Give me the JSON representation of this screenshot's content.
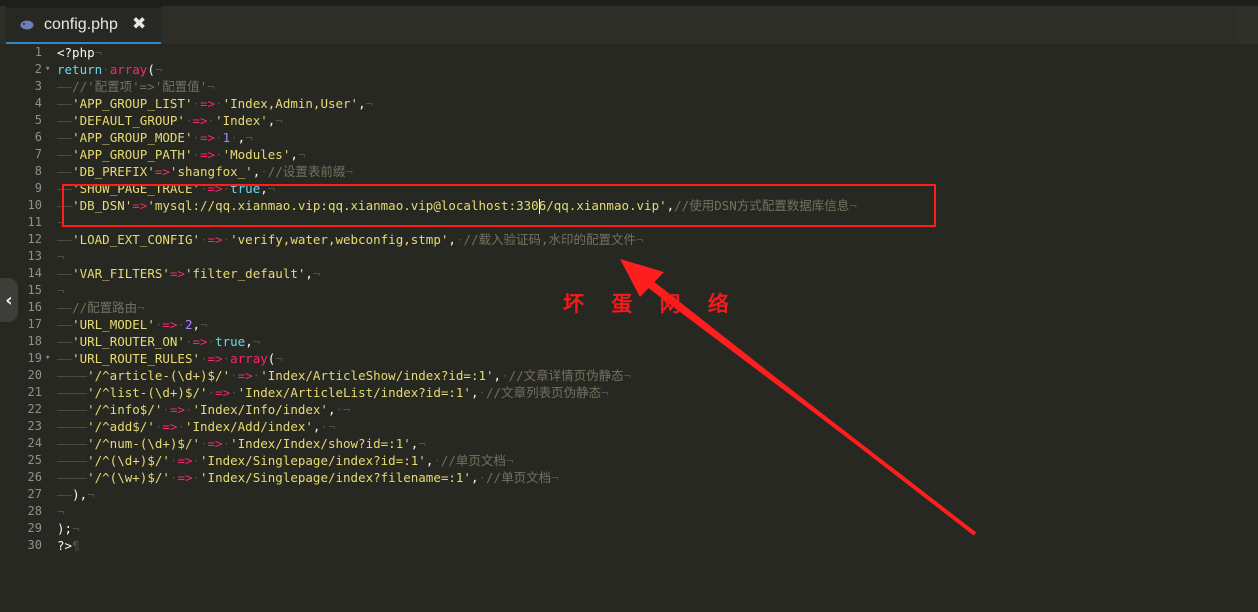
{
  "tab": {
    "title": "config.php",
    "icon": "php-elephant-icon",
    "close": "✖"
  },
  "side_handle": "‹",
  "watermark": "坏 蛋 网 络",
  "lines": [
    {
      "n": "1",
      "fold": "",
      "segs": [
        [
          "t",
          "<?php"
        ],
        [
          "inv",
          "¬"
        ]
      ]
    },
    {
      "n": "2",
      "fold": "▾",
      "segs": [
        [
          "k",
          "return"
        ],
        [
          "inv",
          "·"
        ],
        [
          "o",
          "array"
        ],
        [
          "t",
          "("
        ],
        [
          "inv",
          "¬"
        ]
      ]
    },
    {
      "n": "3",
      "fold": "",
      "segs": [
        [
          "inv",
          "——"
        ],
        [
          "c",
          "//'配置项'=>'配置值'"
        ],
        [
          "inv",
          "¬"
        ]
      ]
    },
    {
      "n": "4",
      "fold": "",
      "segs": [
        [
          "inv",
          "——"
        ],
        [
          "s",
          "'APP_GROUP_LIST'"
        ],
        [
          "inv",
          "·"
        ],
        [
          "o",
          "=>"
        ],
        [
          "inv",
          "·"
        ],
        [
          "s",
          "'Index,Admin,User'"
        ],
        [
          "t",
          ","
        ],
        [
          "inv",
          "¬"
        ]
      ]
    },
    {
      "n": "5",
      "fold": "",
      "segs": [
        [
          "inv",
          "——"
        ],
        [
          "s",
          "'DEFAULT_GROUP'"
        ],
        [
          "inv",
          "·"
        ],
        [
          "o",
          "=>"
        ],
        [
          "inv",
          "·"
        ],
        [
          "s",
          "'Index'"
        ],
        [
          "t",
          ","
        ],
        [
          "inv",
          "¬"
        ]
      ]
    },
    {
      "n": "6",
      "fold": "",
      "segs": [
        [
          "inv",
          "——"
        ],
        [
          "s",
          "'APP_GROUP_MODE'"
        ],
        [
          "inv",
          "·"
        ],
        [
          "o",
          "=>"
        ],
        [
          "inv",
          "·"
        ],
        [
          "n",
          "1"
        ],
        [
          "inv",
          "·"
        ],
        [
          "t",
          ","
        ],
        [
          "inv",
          "¬"
        ]
      ]
    },
    {
      "n": "7",
      "fold": "",
      "segs": [
        [
          "inv",
          "——"
        ],
        [
          "s",
          "'APP_GROUP_PATH'"
        ],
        [
          "inv",
          "·"
        ],
        [
          "o",
          "=>"
        ],
        [
          "inv",
          "·"
        ],
        [
          "s",
          "'Modules'"
        ],
        [
          "t",
          ","
        ],
        [
          "inv",
          "¬"
        ]
      ]
    },
    {
      "n": "8",
      "fold": "",
      "segs": [
        [
          "inv",
          "——"
        ],
        [
          "s",
          "'DB_PREFIX'"
        ],
        [
          "o",
          "=>"
        ],
        [
          "s",
          "'shangfox_'"
        ],
        [
          "t",
          ","
        ],
        [
          "inv",
          "·"
        ],
        [
          "c",
          "//设置表前缀"
        ],
        [
          "inv",
          "¬"
        ]
      ]
    },
    {
      "n": "9",
      "fold": "",
      "segs": [
        [
          "inv",
          "——"
        ],
        [
          "s",
          "'SHOW_PAGE_TRACE'"
        ],
        [
          "inv",
          "·"
        ],
        [
          "o",
          "=>"
        ],
        [
          "inv",
          "·"
        ],
        [
          "k",
          "true"
        ],
        [
          "t",
          ","
        ],
        [
          "inv",
          "¬"
        ]
      ]
    },
    {
      "n": "10",
      "fold": "",
      "segs": [
        [
          "inv",
          "——"
        ],
        [
          "s",
          "'DB_DSN'"
        ],
        [
          "o",
          "=>"
        ],
        [
          "s",
          "'mysql://qq.xianmao.vip:qq.xianmao.vip@localhost:330"
        ],
        [
          "caret",
          ""
        ],
        [
          "s",
          "6/qq.xianmao.vip'"
        ],
        [
          "t",
          ","
        ],
        [
          "c",
          "//使用DSN方式配置数据库信息"
        ],
        [
          "inv",
          "¬"
        ]
      ]
    },
    {
      "n": "11",
      "fold": "",
      "segs": [
        [
          "inv",
          "¬"
        ]
      ]
    },
    {
      "n": "12",
      "fold": "",
      "segs": [
        [
          "inv",
          "——"
        ],
        [
          "s",
          "'LOAD_EXT_CONFIG'"
        ],
        [
          "inv",
          "·"
        ],
        [
          "o",
          "=>"
        ],
        [
          "inv",
          "·"
        ],
        [
          "s",
          "'verify,water,webconfig,stmp'"
        ],
        [
          "t",
          ","
        ],
        [
          "inv",
          "·"
        ],
        [
          "c",
          "//载入验证码,水印的配置文件"
        ],
        [
          "inv",
          "¬"
        ]
      ]
    },
    {
      "n": "13",
      "fold": "",
      "segs": [
        [
          "inv",
          "¬"
        ]
      ]
    },
    {
      "n": "14",
      "fold": "",
      "segs": [
        [
          "inv",
          "——"
        ],
        [
          "s",
          "'VAR_FILTERS'"
        ],
        [
          "o",
          "=>"
        ],
        [
          "s",
          "'filter_default'"
        ],
        [
          "t",
          ","
        ],
        [
          "inv",
          "¬"
        ]
      ]
    },
    {
      "n": "15",
      "fold": "",
      "segs": [
        [
          "inv",
          "¬"
        ]
      ]
    },
    {
      "n": "16",
      "fold": "",
      "segs": [
        [
          "inv",
          "——"
        ],
        [
          "c",
          "//配置路由"
        ],
        [
          "inv",
          "¬"
        ]
      ]
    },
    {
      "n": "17",
      "fold": "",
      "segs": [
        [
          "inv",
          "——"
        ],
        [
          "s",
          "'URL_MODEL'"
        ],
        [
          "inv",
          "·"
        ],
        [
          "o",
          "=>"
        ],
        [
          "inv",
          "·"
        ],
        [
          "n",
          "2"
        ],
        [
          "t",
          ","
        ],
        [
          "inv",
          "¬"
        ]
      ]
    },
    {
      "n": "18",
      "fold": "",
      "segs": [
        [
          "inv",
          "——"
        ],
        [
          "s",
          "'URL_ROUTER_ON'"
        ],
        [
          "inv",
          "·"
        ],
        [
          "o",
          "=>"
        ],
        [
          "inv",
          "·"
        ],
        [
          "k",
          "true"
        ],
        [
          "t",
          ","
        ],
        [
          "inv",
          "¬"
        ]
      ]
    },
    {
      "n": "19",
      "fold": "▾",
      "segs": [
        [
          "inv",
          "——"
        ],
        [
          "s",
          "'URL_ROUTE_RULES'"
        ],
        [
          "inv",
          "·"
        ],
        [
          "o",
          "=>"
        ],
        [
          "inv",
          "·"
        ],
        [
          "o",
          "array"
        ],
        [
          "t",
          "("
        ],
        [
          "inv",
          "¬"
        ]
      ]
    },
    {
      "n": "20",
      "fold": "",
      "segs": [
        [
          "inv",
          "————"
        ],
        [
          "s",
          "'/^article-(\\d+)$/'"
        ],
        [
          "inv",
          "·"
        ],
        [
          "o",
          "=>"
        ],
        [
          "inv",
          "·"
        ],
        [
          "s",
          "'Index/ArticleShow/index?id=:1'"
        ],
        [
          "t",
          ","
        ],
        [
          "inv",
          "·"
        ],
        [
          "c",
          "//文章详情页伪静态"
        ],
        [
          "inv",
          "¬"
        ]
      ]
    },
    {
      "n": "21",
      "fold": "",
      "segs": [
        [
          "inv",
          "————"
        ],
        [
          "s",
          "'/^list-(\\d+)$/'"
        ],
        [
          "inv",
          "·"
        ],
        [
          "o",
          "=>"
        ],
        [
          "inv",
          "·"
        ],
        [
          "s",
          "'Index/ArticleList/index?id=:1'"
        ],
        [
          "t",
          ","
        ],
        [
          "inv",
          "·"
        ],
        [
          "c",
          "//文章列表页伪静态"
        ],
        [
          "inv",
          "¬"
        ]
      ]
    },
    {
      "n": "22",
      "fold": "",
      "segs": [
        [
          "inv",
          "————"
        ],
        [
          "s",
          "'/^info$/'"
        ],
        [
          "inv",
          "·"
        ],
        [
          "o",
          "=>"
        ],
        [
          "inv",
          "·"
        ],
        [
          "s",
          "'Index/Info/index'"
        ],
        [
          "t",
          ","
        ],
        [
          "inv",
          "·¬"
        ]
      ]
    },
    {
      "n": "23",
      "fold": "",
      "segs": [
        [
          "inv",
          "————"
        ],
        [
          "s",
          "'/^add$/'"
        ],
        [
          "inv",
          "·"
        ],
        [
          "o",
          "=>"
        ],
        [
          "inv",
          "·"
        ],
        [
          "s",
          "'Index/Add/index'"
        ],
        [
          "t",
          ","
        ],
        [
          "inv",
          "·¬"
        ]
      ]
    },
    {
      "n": "24",
      "fold": "",
      "segs": [
        [
          "inv",
          "————"
        ],
        [
          "s",
          "'/^num-(\\d+)$/'"
        ],
        [
          "inv",
          "·"
        ],
        [
          "o",
          "=>"
        ],
        [
          "inv",
          "·"
        ],
        [
          "s",
          "'Index/Index/show?id=:1'"
        ],
        [
          "t",
          ","
        ],
        [
          "inv",
          "¬"
        ]
      ]
    },
    {
      "n": "25",
      "fold": "",
      "segs": [
        [
          "inv",
          "————"
        ],
        [
          "s",
          "'/^(\\d+)$/'"
        ],
        [
          "inv",
          "·"
        ],
        [
          "o",
          "=>"
        ],
        [
          "inv",
          "·"
        ],
        [
          "s",
          "'Index/Singlepage/index?id=:1'"
        ],
        [
          "t",
          ","
        ],
        [
          "inv",
          "·"
        ],
        [
          "c",
          "//单页文档"
        ],
        [
          "inv",
          "¬"
        ]
      ]
    },
    {
      "n": "26",
      "fold": "",
      "segs": [
        [
          "inv",
          "————"
        ],
        [
          "s",
          "'/^(\\w+)$/'"
        ],
        [
          "inv",
          "·"
        ],
        [
          "o",
          "=>"
        ],
        [
          "inv",
          "·"
        ],
        [
          "s",
          "'Index/Singlepage/index?filename=:1'"
        ],
        [
          "t",
          ","
        ],
        [
          "inv",
          "·"
        ],
        [
          "c",
          "//单页文档"
        ],
        [
          "inv",
          "¬"
        ]
      ]
    },
    {
      "n": "27",
      "fold": "",
      "segs": [
        [
          "inv",
          "——"
        ],
        [
          "t",
          "),"
        ],
        [
          "inv",
          "¬"
        ]
      ]
    },
    {
      "n": "28",
      "fold": "",
      "segs": [
        [
          "inv",
          "¬"
        ]
      ]
    },
    {
      "n": "29",
      "fold": "",
      "segs": [
        [
          "t",
          ");"
        ],
        [
          "inv",
          "¬"
        ]
      ]
    },
    {
      "n": "30",
      "fold": "",
      "segs": [
        [
          "t",
          "?>"
        ],
        [
          "inv",
          "¶"
        ]
      ]
    }
  ]
}
